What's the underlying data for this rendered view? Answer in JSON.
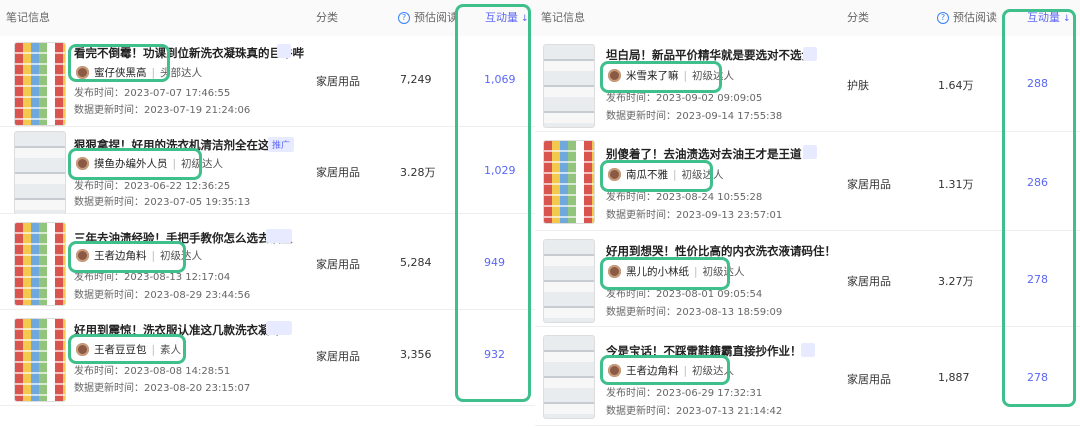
{
  "left": {
    "headers": {
      "note_info": "笔记信息",
      "category": "分类",
      "reads": "预估阅读",
      "interactions": "互动量"
    },
    "rows": [
      {
        "title": "看完不倒霉！功课到位新洗衣凝珠真的巨牛哔",
        "author": "蜜仔侠黑高",
        "level": "头部达人",
        "published": "发布时间：2023-07-07 17:46:55",
        "updated": "数据更新时间：2023-07-19 21:24:06",
        "category": "家居用品",
        "reads": "7,249",
        "interactions": "1,069"
      },
      {
        "title": "狠狠拿捏！好用的洗衣机清洁剂全在这了！",
        "tag": "推广",
        "author": "摸鱼办编外人员",
        "level": "初级达人",
        "published": "发布时间：2023-06-22 12:36:25",
        "updated": "数据更新时间：2023-07-05 19:35:13",
        "category": "家居用品",
        "reads": "3.28万",
        "interactions": "1,029"
      },
      {
        "title": "三年去油渍经验！手把手教你怎么选去油王",
        "author": "王者边角料",
        "level": "初级达人",
        "published": "发布时间：2023-08-13 12:17:04",
        "updated": "数据更新时间：2023-08-29 23:44:56",
        "category": "家居用品",
        "reads": "5,284",
        "interactions": "949"
      },
      {
        "title": "好用到震惊！洗衣服认准这几款洗衣凝珠！",
        "author": "王者豆豆包",
        "level": "素人",
        "published": "发布时间：2023-08-08 14:28:51",
        "updated": "数据更新时间：2023-08-20 23:15:07",
        "category": "家居用品",
        "reads": "3,356",
        "interactions": "932"
      }
    ]
  },
  "right": {
    "headers": {
      "note_info": "笔记信息",
      "category": "分类",
      "reads": "预估阅读",
      "interactions": "互动量"
    },
    "rows": [
      {
        "title": "坦白局！新品平价精华就是要选对不选贵",
        "author": "米雪来了嘛",
        "level": "初级达人",
        "published": "发布时间：2023-09-02 09:09:05",
        "updated": "数据更新时间：2023-09-14 17:55:38",
        "category": "护肤",
        "reads": "1.64万",
        "interactions": "288"
      },
      {
        "title": "别傻着了！去油渍选对去油王才是王道！",
        "author": "南瓜不雅",
        "level": "初级达人",
        "published": "发布时间：2023-08-24 10:55:28",
        "updated": "数据更新时间：2023-09-13 23:57:01",
        "category": "家居用品",
        "reads": "1.31万",
        "interactions": "286"
      },
      {
        "title": "好用到想哭！性价比高的内衣洗衣液请码住！",
        "author": "黑儿的小林纸",
        "level": "初级达人",
        "published": "发布时间：2023-08-01 09:05:54",
        "updated": "数据更新时间：2023-08-13 18:59:09",
        "category": "家居用品",
        "reads": "3.27万",
        "interactions": "278"
      },
      {
        "title": "今是宝话！不踩雷鞋籍霸直接抄作业！",
        "author": "王者边角料",
        "level": "初级达人",
        "published": "发布时间：2023-06-29 17:32:31",
        "updated": "数据更新时间：2023-07-13 21:14:42",
        "category": "家居用品",
        "reads": "1,887",
        "interactions": "278"
      }
    ]
  },
  "icons": {
    "info": "info-circle-icon",
    "sort": "sort-icon"
  },
  "colors": {
    "accent": "#5b67f5",
    "highlight": "#3fbf8c",
    "tag_bg": "#e8ebff"
  }
}
